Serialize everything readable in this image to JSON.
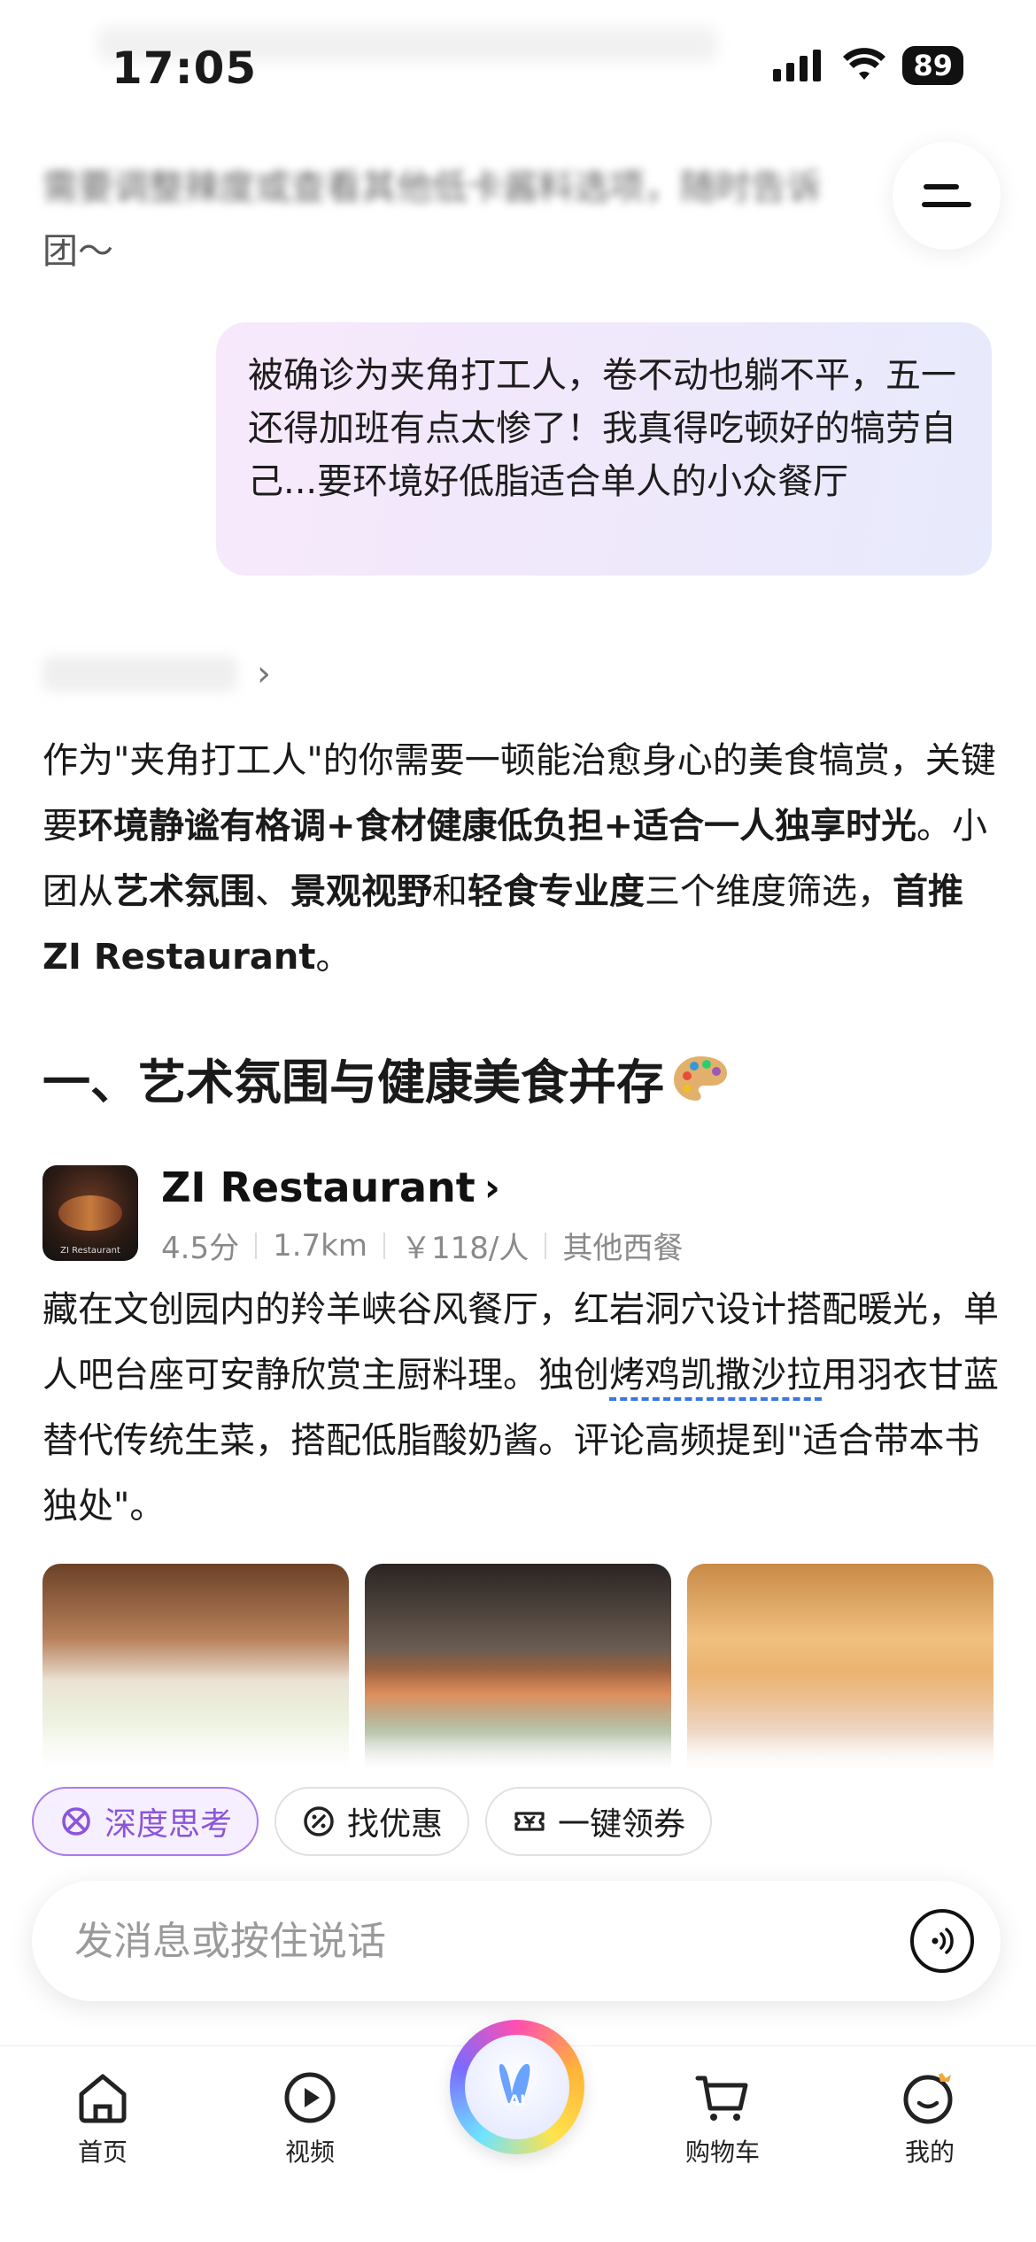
{
  "status_bar": {
    "time": "17:05",
    "battery": "89"
  },
  "prev_message": {
    "line1": "需要调整辣度或查看其他低卡酱料选项，随时告诉",
    "line2": "团～"
  },
  "user_message": {
    "text": "被确诊为夹角打工人，卷不动也躺不平，五一还得加班有点太惨了！我真得吃顿好的犒劳自己...要环境好低脂适合单人的小众餐厅"
  },
  "answer": {
    "p1": "作为\"夹角打工人\"的你需要一顿能治愈身心的美食犒赏，关键要",
    "p1_bold": "环境静谧有格调+食材健康低负担+适合一人独享时光",
    "p2": "。小团从",
    "p2_bold1": "艺术氛围",
    "p2_sep1": "、",
    "p2_bold2": "景观视野",
    "p2_sep2": "和",
    "p2_bold3": "轻食专业度",
    "p2_mid": "三个维度筛选，",
    "p2_bold4": "首推ZI Restaurant",
    "p2_end": "。"
  },
  "section": {
    "title": "一、艺术氛围与健康美食并存"
  },
  "restaurant": {
    "name": "ZI Restaurant",
    "thumb_caption": "ZI Restaurant",
    "rating": "4.5分",
    "distance": "1.7km",
    "price": "￥118/人",
    "category": "其他西餐",
    "desc_a": "藏在文创园内的羚羊峡谷风餐厅，红岩洞穴设计搭配暖光，单人吧台座可安静欣赏主厨料理。独创",
    "desc_link": "烤鸡凯撒沙拉",
    "desc_b": "用羽衣甘蓝替代传统生菜，搭配低脂酸奶酱。评论高频提到\"适合带本书独处\"。"
  },
  "chips": [
    {
      "label": "深度思考",
      "icon": "deep-think-icon"
    },
    {
      "label": "找优惠",
      "icon": "discount-icon"
    },
    {
      "label": "一键领券",
      "icon": "coupon-icon"
    }
  ],
  "input": {
    "placeholder": "发消息或按住说话"
  },
  "tabs": [
    {
      "label": "首页",
      "icon": "home-icon"
    },
    {
      "label": "视频",
      "icon": "video-icon"
    },
    {
      "label": "",
      "icon": "ai-assistant-icon"
    },
    {
      "label": "购物车",
      "icon": "cart-icon"
    },
    {
      "label": "我的",
      "icon": "profile-icon"
    }
  ],
  "colors": {
    "accent_purple": "#8b55d9",
    "link_blue": "#3a77e3"
  }
}
